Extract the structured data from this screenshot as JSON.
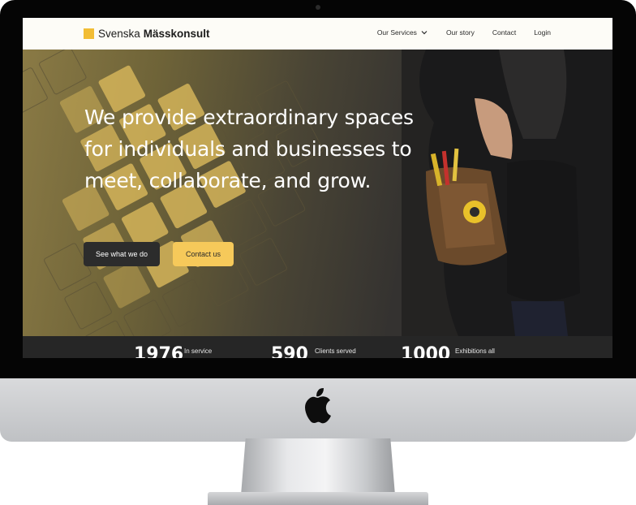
{
  "brand": {
    "name_light": "Svenska",
    "name_bold": "Mässkonsult",
    "accent_color": "#f2bd35"
  },
  "nav": {
    "items": [
      {
        "label": "Our Services",
        "icon": "chevron-down-icon"
      },
      {
        "label": "Our story"
      },
      {
        "label": "Contact"
      },
      {
        "label": "Login"
      }
    ]
  },
  "hero": {
    "headline": "We provide extraordinary spaces for individuals and businesses to meet, collaborate, and grow.",
    "primary_button": "See what we do",
    "secondary_button": "Contact us",
    "secondary_color": "#f6c95a"
  },
  "stats": [
    {
      "value": "1976",
      "label": "In service"
    },
    {
      "value": "590",
      "label": "Clients served"
    },
    {
      "value": "1000",
      "label": "Exhibitions all"
    }
  ],
  "device": {
    "logo": "apple-logo"
  }
}
